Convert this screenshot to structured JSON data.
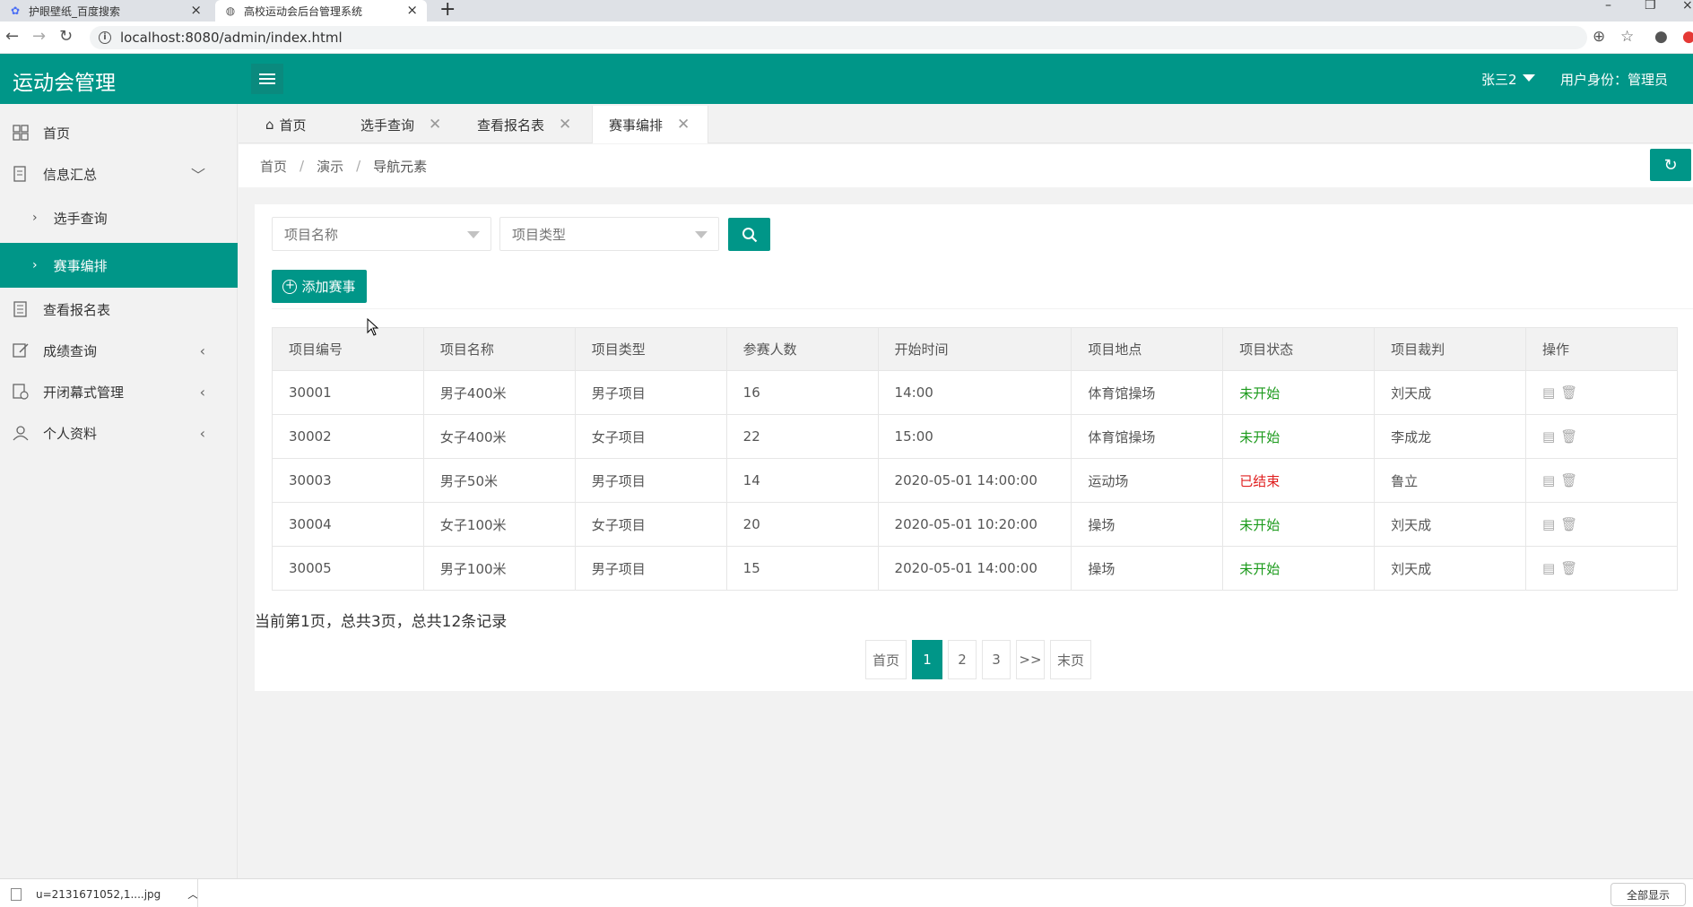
{
  "browser": {
    "tabs": [
      {
        "title": "护眼壁纸_百度搜索"
      },
      {
        "title": "高校运动会后台管理系统"
      }
    ],
    "new_tab": "+",
    "url": "localhost:8080/admin/index.html"
  },
  "header": {
    "logo": "运动会管理",
    "user": "张三2",
    "role": "用户身份：管理员"
  },
  "sidebar": {
    "items": [
      {
        "label": "首页",
        "icon": "grid-icon"
      },
      {
        "label": "信息汇总",
        "icon": "document-icon"
      },
      {
        "label": "选手查询"
      },
      {
        "label": "赛事编排"
      },
      {
        "label": "查看报名表",
        "icon": "list-icon"
      },
      {
        "label": "成绩查询",
        "icon": "edit-icon"
      },
      {
        "label": "开闭幕式管理",
        "icon": "document-check-icon"
      },
      {
        "label": "个人资料",
        "icon": "user-icon"
      }
    ]
  },
  "content_tabs": [
    {
      "label": "首页"
    },
    {
      "label": "选手查询"
    },
    {
      "label": "查看报名表"
    },
    {
      "label": "赛事编排"
    }
  ],
  "breadcrumb": [
    "首页",
    "演示",
    "导航元素"
  ],
  "filters": {
    "project_name_placeholder": "项目名称",
    "project_type_placeholder": "项目类型"
  },
  "add_button": "添加赛事",
  "table": {
    "headers": [
      "项目编号",
      "项目名称",
      "项目类型",
      "参赛人数",
      "开始时间",
      "项目地点",
      "项目状态",
      "项目裁判",
      "操作"
    ],
    "rows": [
      {
        "id": "30001",
        "name": "男子400米",
        "type": "男子项目",
        "count": "16",
        "time": "14:00",
        "place": "体育馆操场",
        "status": "未开始",
        "referee": "刘天成"
      },
      {
        "id": "30002",
        "name": "女子400米",
        "type": "女子项目",
        "count": "22",
        "time": "15:00",
        "place": "体育馆操场",
        "status": "未开始",
        "referee": "李成龙"
      },
      {
        "id": "30003",
        "name": "男子50米",
        "type": "男子项目",
        "count": "14",
        "time": "2020-05-01 14:00:00",
        "place": "运动场",
        "status": "已结束",
        "referee": "鲁立"
      },
      {
        "id": "30004",
        "name": "女子100米",
        "type": "女子项目",
        "count": "20",
        "time": "2020-05-01 10:20:00",
        "place": "操场",
        "status": "未开始",
        "referee": "刘天成"
      },
      {
        "id": "30005",
        "name": "男子100米",
        "type": "男子项目",
        "count": "15",
        "time": "2020-05-01 14:00:00",
        "place": "操场",
        "status": "未开始",
        "referee": "刘天成"
      }
    ]
  },
  "summary": "当前第1页，总共3页，总共12条记录",
  "pager": [
    "首页",
    "1",
    "2",
    "3",
    ">>",
    "末页"
  ],
  "download_bar": {
    "file": "u=2131671052,1....jpg",
    "show_all": "全部显示"
  },
  "colors": {
    "brand": "#009688",
    "status_pending": "#1b9a1b",
    "status_done": "#e02020"
  }
}
